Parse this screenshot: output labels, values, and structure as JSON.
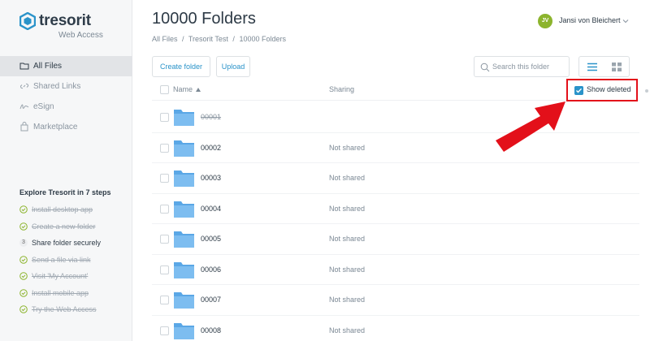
{
  "app": {
    "brand": "tresorit",
    "sub": "Web Access"
  },
  "sidebar": {
    "items": [
      {
        "label": "All Files",
        "icon": "folder-icon",
        "active": true
      },
      {
        "label": "Shared Links",
        "icon": "link-icon",
        "active": false
      },
      {
        "label": "eSign",
        "icon": "signature-icon",
        "active": false
      },
      {
        "label": "Marketplace",
        "icon": "shop-icon",
        "active": false
      }
    ],
    "explore": {
      "title": "Explore Tresorit in 7 steps",
      "steps": [
        {
          "label": "Install desktop app",
          "done": true
        },
        {
          "label": "Create a new folder",
          "done": true
        },
        {
          "label": "Share folder securely",
          "done": false,
          "number": "3"
        },
        {
          "label": "Send a file via link",
          "done": true
        },
        {
          "label": "Visit 'My Account'",
          "done": true
        },
        {
          "label": "Install mobile app",
          "done": true
        },
        {
          "label": "Try the Web Access",
          "done": true
        }
      ]
    }
  },
  "header": {
    "title": "10000 Folders",
    "breadcrumb": [
      "All Files",
      "/",
      "Tresorit Test",
      "/",
      "10000 Folders"
    ],
    "user": {
      "initials": "JV",
      "name": "Jansi von Bleichert"
    }
  },
  "toolbar": {
    "create_label": "Create folder",
    "upload_label": "Upload",
    "search_placeholder": "Search this folder"
  },
  "table": {
    "col_name": "Name",
    "col_sharing": "Sharing",
    "show_deleted_label": "Show deleted",
    "show_deleted_checked": true,
    "rows": [
      {
        "name": "00001",
        "sharing": "",
        "deleted": true
      },
      {
        "name": "00002",
        "sharing": "Not shared",
        "deleted": false
      },
      {
        "name": "00003",
        "sharing": "Not shared",
        "deleted": false
      },
      {
        "name": "00004",
        "sharing": "Not shared",
        "deleted": false
      },
      {
        "name": "00005",
        "sharing": "Not shared",
        "deleted": false
      },
      {
        "name": "00006",
        "sharing": "Not shared",
        "deleted": false
      },
      {
        "name": "00007",
        "sharing": "Not shared",
        "deleted": false
      },
      {
        "name": "00008",
        "sharing": "Not shared",
        "deleted": false
      }
    ]
  },
  "colors": {
    "accent": "#2a93c9",
    "highlight": "#e3101a",
    "avatar": "#8cb42d",
    "folder": "#5aa7e6"
  }
}
